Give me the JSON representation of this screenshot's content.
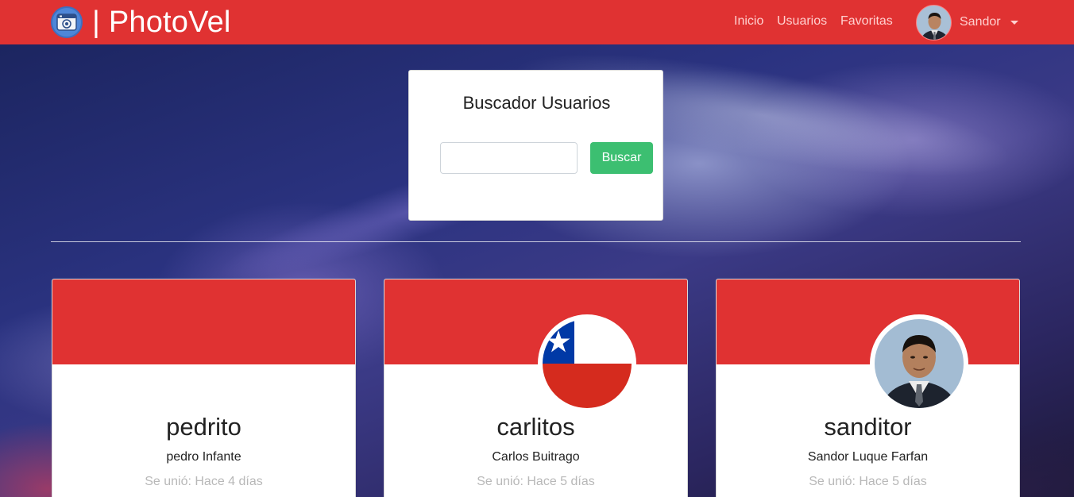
{
  "navbar": {
    "brand": "| PhotoVel",
    "brand_logo_icon": "camera-window-icon",
    "links": [
      "Inicio",
      "Usuarios",
      "Favoritas"
    ],
    "user_name": "Sandor",
    "dropdown_icon": "caret-down-icon"
  },
  "search": {
    "title": "Buscador Usuarios",
    "input_value": "",
    "placeholder": "",
    "button_label": "Buscar"
  },
  "users": [
    {
      "username": "pedrito",
      "full_name": "pedro Infante",
      "joined": "Se unió: Hace 4 días",
      "avatar": "none"
    },
    {
      "username": "carlitos",
      "full_name": "Carlos Buitrago",
      "joined": "Se unió: Hace 5 días",
      "avatar": "chile-flag-icon"
    },
    {
      "username": "sanditor",
      "full_name": "Sandor Luque Farfan",
      "joined": "Se unió: Hace 5 días",
      "avatar": "person-photo"
    }
  ],
  "colors": {
    "primary_red": "#e03232",
    "success_green": "#3cbf71",
    "nav_link": "#ffd0cf"
  }
}
